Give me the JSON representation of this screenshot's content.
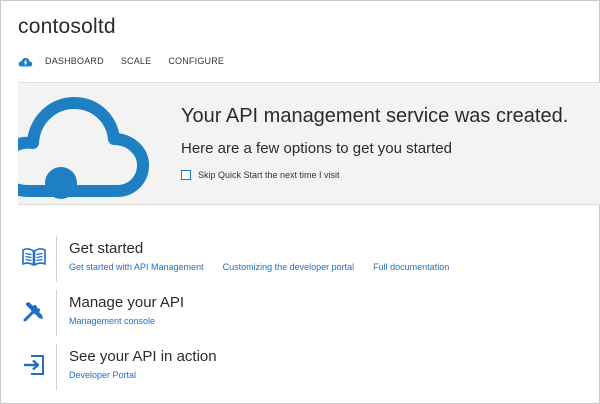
{
  "header": {
    "title": "contosoltd"
  },
  "nav": {
    "logo_icon": "cloud-bolt-icon",
    "items": [
      {
        "label": "DASHBOARD"
      },
      {
        "label": "SCALE"
      },
      {
        "label": "CONFIGURE"
      }
    ]
  },
  "hero": {
    "headline": "Your API management service was created.",
    "subheadline": "Here are a few options to get you started",
    "skip_label": "Skip Quick Start the next time I visit",
    "skip_checked": false,
    "icon": "cloud-icon"
  },
  "sections": [
    {
      "title": "Get started",
      "icon": "book-icon",
      "links": [
        {
          "label": "Get started with API Management"
        },
        {
          "label": "Customizing the developer portal"
        },
        {
          "label": "Full documentation"
        }
      ]
    },
    {
      "title": "Manage your API",
      "icon": "tools-icon",
      "links": [
        {
          "label": "Management console"
        }
      ]
    },
    {
      "title": "See your API in action",
      "icon": "sign-in-icon",
      "links": [
        {
          "label": "Developer Portal"
        }
      ]
    }
  ],
  "colors": {
    "accent": "#1e7fc2",
    "link": "#1e6fc4",
    "hero_bg": "#f3f3f3"
  }
}
